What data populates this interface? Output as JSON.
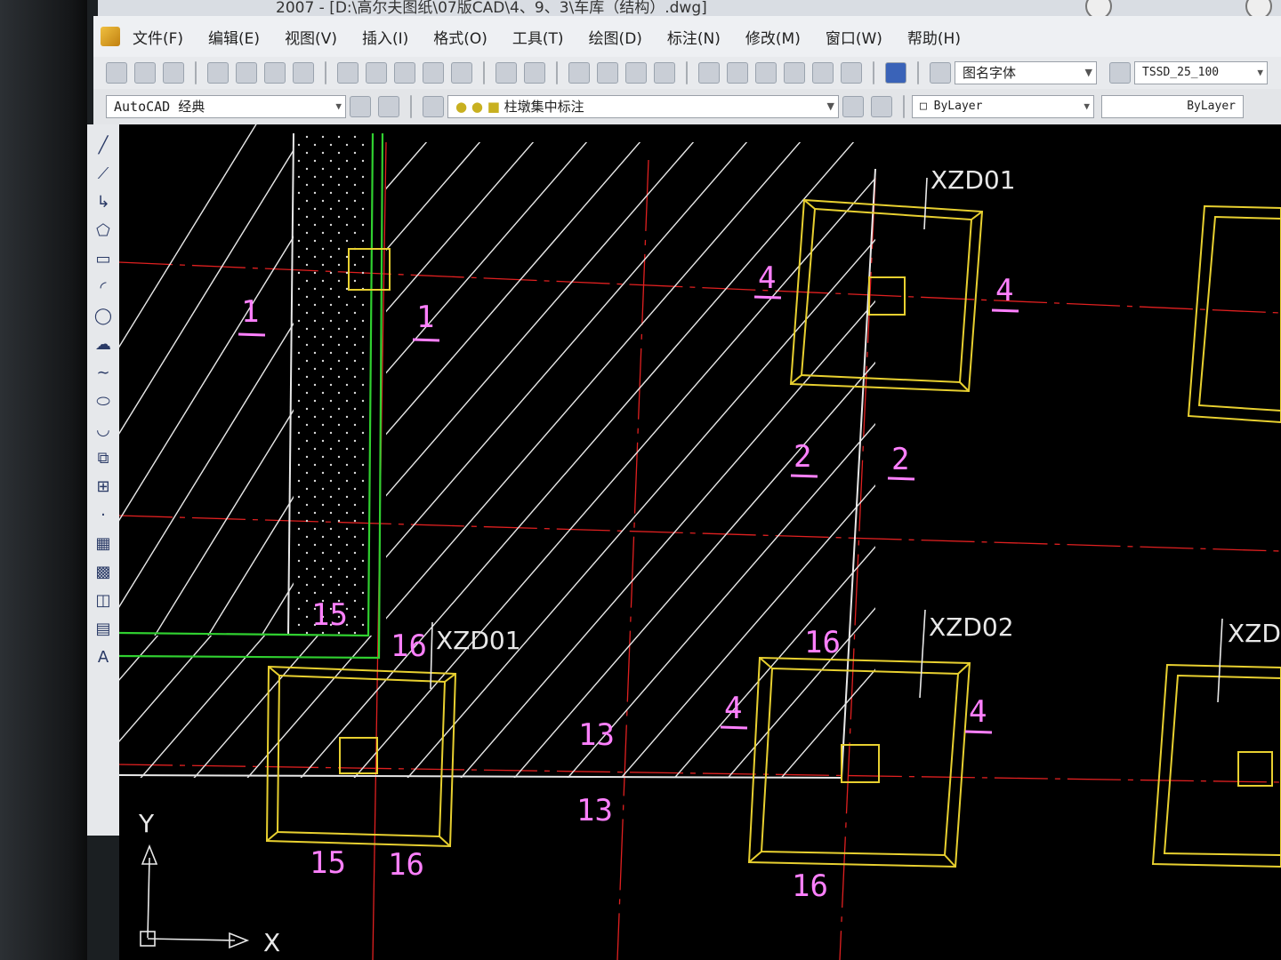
{
  "window": {
    "title": "2007 - [D:\\高尔夫图纸\\07版CAD\\4、9、3\\车库（结构）.dwg]"
  },
  "menu": [
    "文件(F)",
    "编辑(E)",
    "视图(V)",
    "插入(I)",
    "格式(O)",
    "工具(T)",
    "绘图(D)",
    "标注(N)",
    "修改(M)",
    "窗口(W)",
    "帮助(H)"
  ],
  "toolbar": {
    "workspace": "AutoCAD 经典",
    "layer": "柱墩集中标注",
    "text_style": "图名字体",
    "dim_style": "TSSD_25_100",
    "color": "ByLayer",
    "linetype": "ByLayer"
  },
  "drawing": {
    "labels": {
      "top_left_pile_tag": "XZD01",
      "left_1": "1",
      "mid_1": "1",
      "top_4_left": "4",
      "top_4_right": "4",
      "mid_2_left": "2",
      "mid_2_right": "2",
      "l15_top": "15",
      "l16_top": "16",
      "tag_xzd01": "XZD01",
      "tag_xzd02": "XZD02",
      "tag_xzd0_right": "XZD0",
      "bot_16_right_top": "16",
      "bot_4_left": "4",
      "bot_4_right": "4",
      "l13_a": "13",
      "l13_b": "13",
      "l15_bot": "15",
      "l16_bot": "16",
      "l16_right_bot": "16"
    },
    "ucs": {
      "x": "X",
      "y": "Y"
    },
    "colors": {
      "background": "#000000",
      "hatch": "#e8e8e8",
      "axis": "#e02020",
      "pile": "#e8d030",
      "wall": "#30d030",
      "label": "#ff80ff"
    }
  }
}
